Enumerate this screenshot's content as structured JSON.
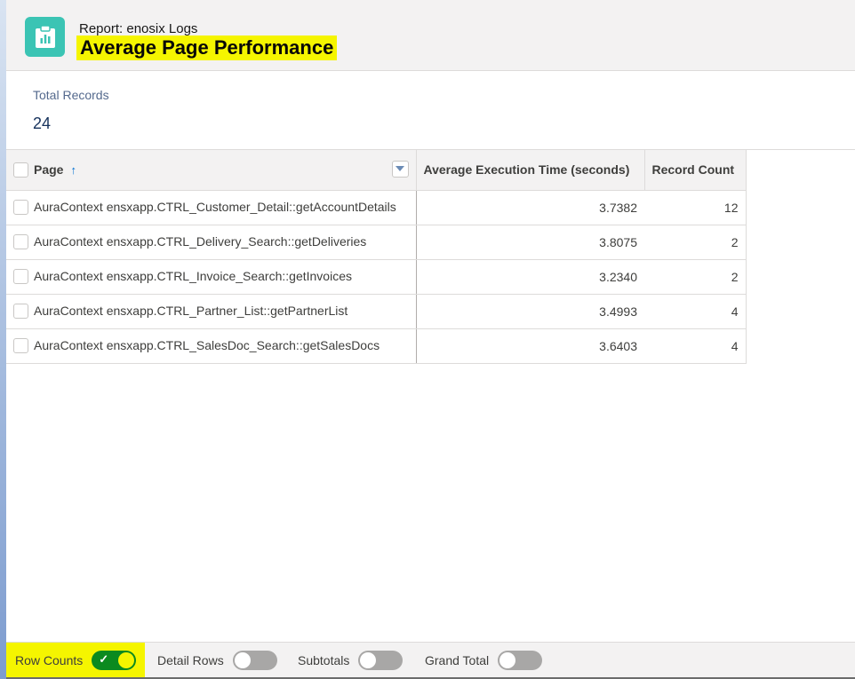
{
  "header": {
    "subtitle": "Report: enosix Logs",
    "title": "Average Page Performance",
    "icon": "report-icon",
    "highlight_color": "#f5f500"
  },
  "summary": {
    "label": "Total Records",
    "value": "24"
  },
  "table": {
    "columns": [
      "Page",
      "Average Execution Time (seconds)",
      "Record Count"
    ],
    "sort_indicator": "↑",
    "rows": [
      {
        "page": "AuraContext ensxapp.CTRL_Customer_Detail::getAccountDetails",
        "avg": "3.7382",
        "count": "12"
      },
      {
        "page": "AuraContext ensxapp.CTRL_Delivery_Search::getDeliveries",
        "avg": "3.8075",
        "count": "2"
      },
      {
        "page": "AuraContext ensxapp.CTRL_Invoice_Search::getInvoices",
        "avg": "3.2340",
        "count": "2"
      },
      {
        "page": "AuraContext ensxapp.CTRL_Partner_List::getPartnerList",
        "avg": "3.4993",
        "count": "4"
      },
      {
        "page": "AuraContext ensxapp.CTRL_SalesDoc_Search::getSalesDocs",
        "avg": "3.6403",
        "count": "4"
      }
    ]
  },
  "footer": {
    "toggles": [
      {
        "label": "Row Counts",
        "on": true
      },
      {
        "label": "Detail Rows",
        "on": false
      },
      {
        "label": "Subtotals",
        "on": false
      },
      {
        "label": "Grand Total",
        "on": false
      }
    ]
  },
  "colors": {
    "accent": "#3bc4b4",
    "toggle_on": "#0b8a1f"
  }
}
